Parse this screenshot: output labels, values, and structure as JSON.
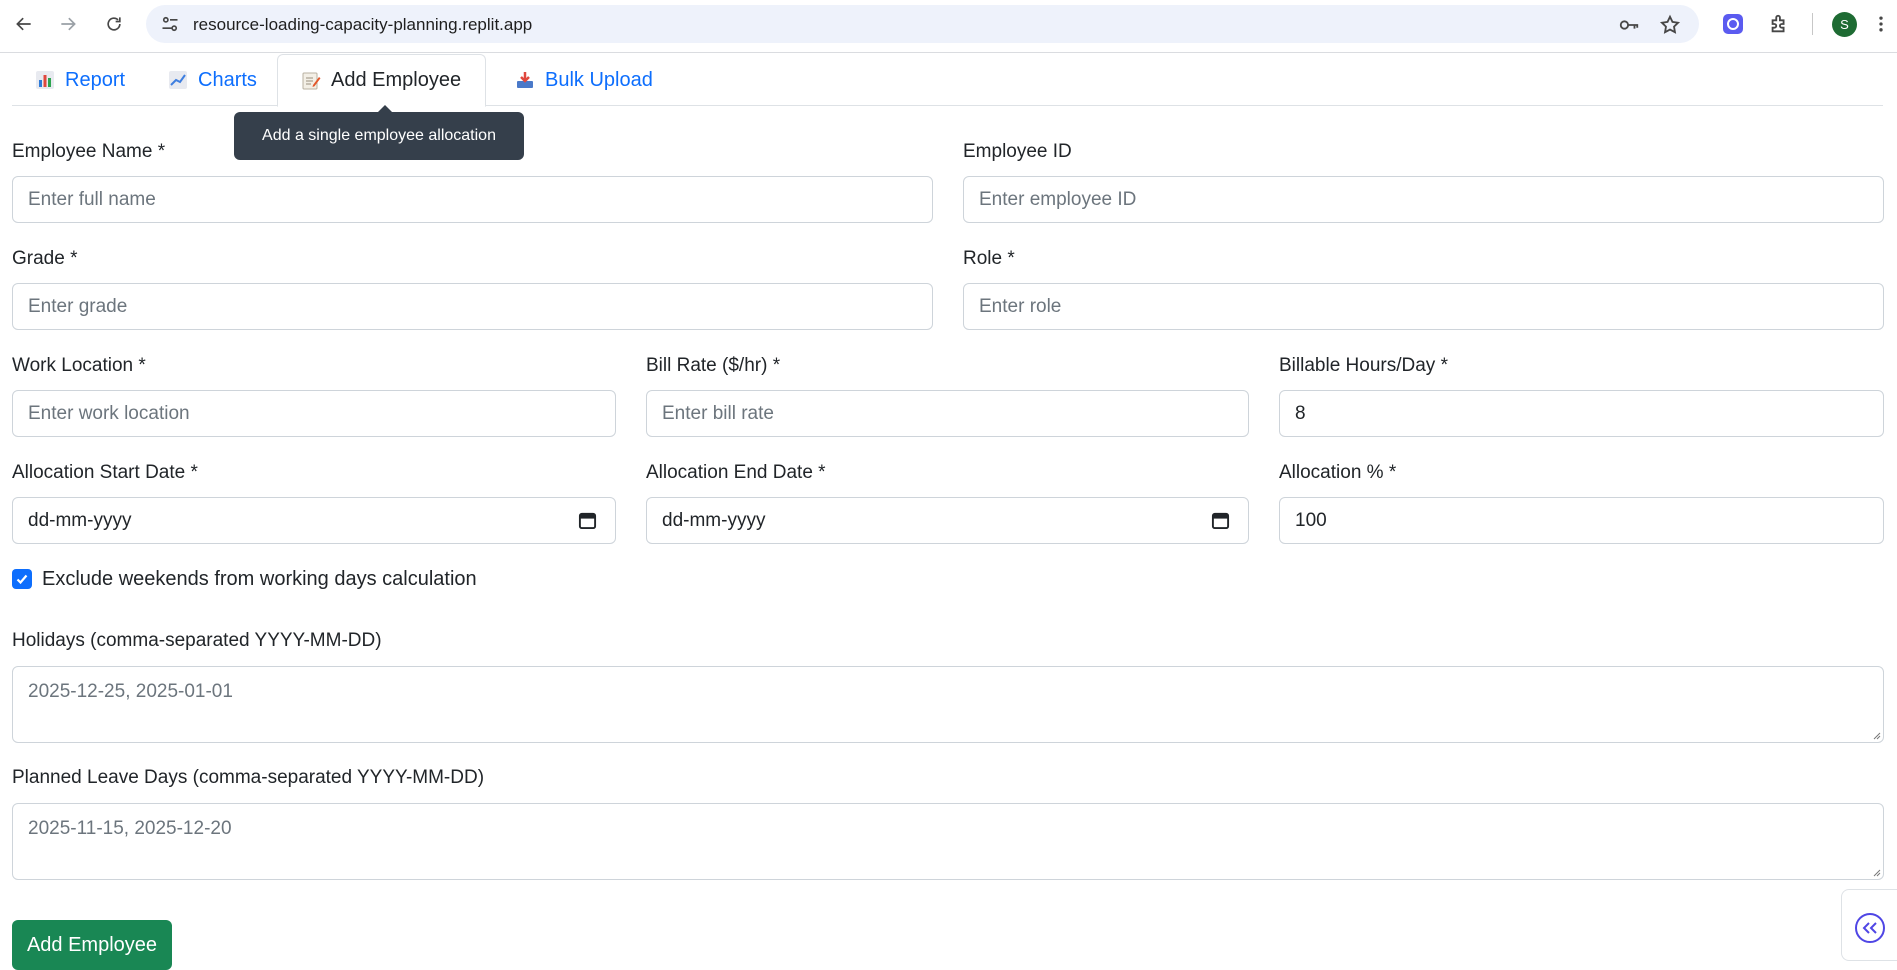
{
  "browser": {
    "url": "resource-loading-capacity-planning.replit.app",
    "profile_initial": "S"
  },
  "tabs": [
    {
      "label": "Report",
      "icon": "bar-chart-icon"
    },
    {
      "label": "Charts",
      "icon": "line-chart-icon"
    },
    {
      "label": "Add Employee",
      "icon": "memo-icon"
    },
    {
      "label": "Bulk Upload",
      "icon": "inbox-tray-icon"
    }
  ],
  "active_tab": "Add Employee",
  "tooltip": "Add a single employee allocation",
  "form": {
    "employee_name": {
      "label": "Employee Name *",
      "placeholder": "Enter full name"
    },
    "employee_id": {
      "label": "Employee ID",
      "placeholder": "Enter employee ID"
    },
    "grade": {
      "label": "Grade *",
      "placeholder": "Enter grade"
    },
    "role": {
      "label": "Role *",
      "placeholder": "Enter role"
    },
    "work_location": {
      "label": "Work Location *",
      "placeholder": "Enter work location"
    },
    "bill_rate": {
      "label": "Bill Rate ($/hr) *",
      "placeholder": "Enter bill rate"
    },
    "billable_hours": {
      "label": "Billable Hours/Day *",
      "value": "8"
    },
    "start_date": {
      "label": "Allocation Start Date *",
      "placeholder": "dd-mm-yyyy"
    },
    "end_date": {
      "label": "Allocation End Date *",
      "placeholder": "dd-mm-yyyy"
    },
    "allocation_pct": {
      "label": "Allocation % *",
      "value": "100"
    },
    "exclude_weekends": {
      "label": "Exclude weekends from working days calculation",
      "checked": true
    },
    "holidays": {
      "label": "Holidays (comma-separated YYYY-MM-DD)",
      "placeholder": "2025-12-25, 2025-01-01"
    },
    "planned_leave": {
      "label": "Planned Leave Days (comma-separated YYYY-MM-DD)",
      "placeholder": "2025-11-15, 2025-12-20"
    },
    "submit_label": "Add Employee"
  },
  "colors": {
    "primary": "#0d6efd",
    "success": "#198754",
    "tooltip_bg": "#353f4b",
    "accent": "#4f46e5"
  }
}
